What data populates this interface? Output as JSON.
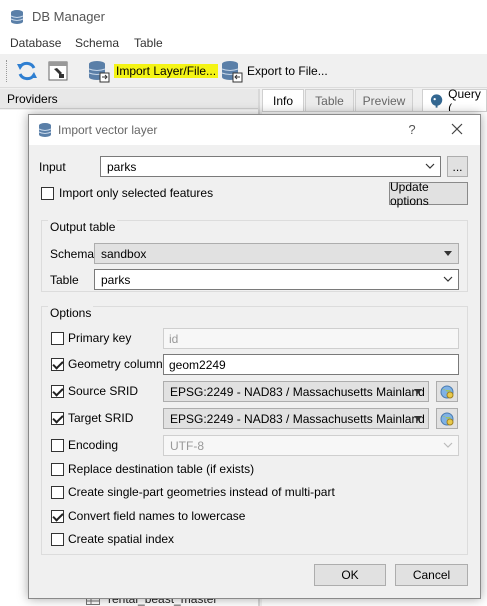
{
  "main": {
    "title": "DB Manager",
    "menu": [
      "Database",
      "Schema",
      "Table"
    ],
    "toolbar": {
      "import_label": "Import Layer/File...",
      "export_label": "Export to File..."
    },
    "providers_label": "Providers",
    "tabs": [
      "Info",
      "Table",
      "Preview",
      "Query ("
    ],
    "tree_item": "rental_beast_master"
  },
  "dialog": {
    "title": "Import vector layer",
    "help": "?",
    "input_label": "Input",
    "input_value": "parks",
    "browse_label": "...",
    "import_selected_label": "Import only selected features",
    "update_options_label": "Update options",
    "output_table_group": "Output table",
    "schema_label": "Schema",
    "schema_value": "sandbox",
    "table_label": "Table",
    "table_value": "parks",
    "options_group": "Options",
    "primary_key_label": "Primary key",
    "primary_key_value": "id",
    "geometry_column_label": "Geometry column",
    "geometry_column_value": "geom2249",
    "source_srid_label": "Source SRID",
    "source_srid_value": "EPSG:2249 - NAD83 / Massachusetts Mainland (ftU",
    "target_srid_label": "Target SRID",
    "target_srid_value": "EPSG:2249 - NAD83 / Massachusetts Mainland (ftU",
    "encoding_label": "Encoding",
    "encoding_value": "UTF-8",
    "replace_label": "Replace destination table (if exists)",
    "single_part_label": "Create single-part geometries instead of multi-part",
    "lowercase_label": "Convert field names to lowercase",
    "spatial_index_label": "Create spatial index",
    "ok_label": "OK",
    "cancel_label": "Cancel"
  },
  "state": {
    "import_selected": false,
    "primary_key": false,
    "geometry_column": true,
    "source_srid": true,
    "target_srid": true,
    "encoding": false,
    "replace": false,
    "single_part": false,
    "lowercase": true,
    "spatial_index": false
  },
  "colors": {
    "highlight": "#f4f415",
    "db_icon": "#5a7fa8"
  }
}
